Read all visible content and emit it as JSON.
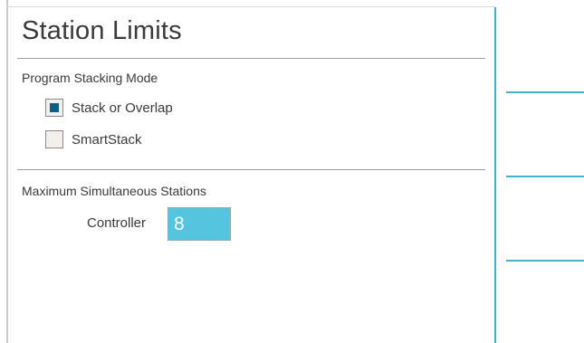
{
  "page": {
    "title": "Station Limits"
  },
  "stacking": {
    "label": "Program Stacking Mode",
    "options": [
      {
        "label": "Stack or Overlap",
        "checked": true
      },
      {
        "label": "SmartStack",
        "checked": false
      }
    ]
  },
  "max_stations": {
    "label": "Maximum Simultaneous Stations",
    "controller_label": "Controller",
    "controller_value": "8"
  },
  "colors": {
    "accent": "#3fb4d1",
    "field_bg": "#55c4de",
    "checkbox_mark": "#0f5e85"
  }
}
